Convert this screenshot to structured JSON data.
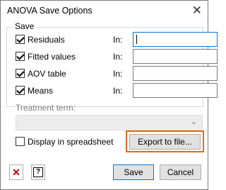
{
  "window": {
    "title": "ANOVA Save Options",
    "close_glyph": "✕"
  },
  "save_group": {
    "label": "Save",
    "in_label": "In:",
    "items": [
      {
        "label": "Residuals",
        "checked": true,
        "in_value": ""
      },
      {
        "label": "Fitted values",
        "checked": true,
        "in_value": ""
      },
      {
        "label": "AOV table",
        "checked": true,
        "in_value": ""
      },
      {
        "label": "Means",
        "checked": true,
        "in_value": ""
      }
    ]
  },
  "treatment": {
    "label": "Treatment term:",
    "value": "",
    "chevron": "⌄"
  },
  "display_spreadsheet": {
    "label": "Display in spreadsheet",
    "checked": false
  },
  "buttons": {
    "export": "Export to file...",
    "save": "Save",
    "cancel": "Cancel",
    "clear_icon": "✕",
    "help_icon": "?"
  },
  "colors": {
    "highlight": "#e36c09",
    "focus": "#0078d7",
    "clear_red": "#c00000"
  }
}
